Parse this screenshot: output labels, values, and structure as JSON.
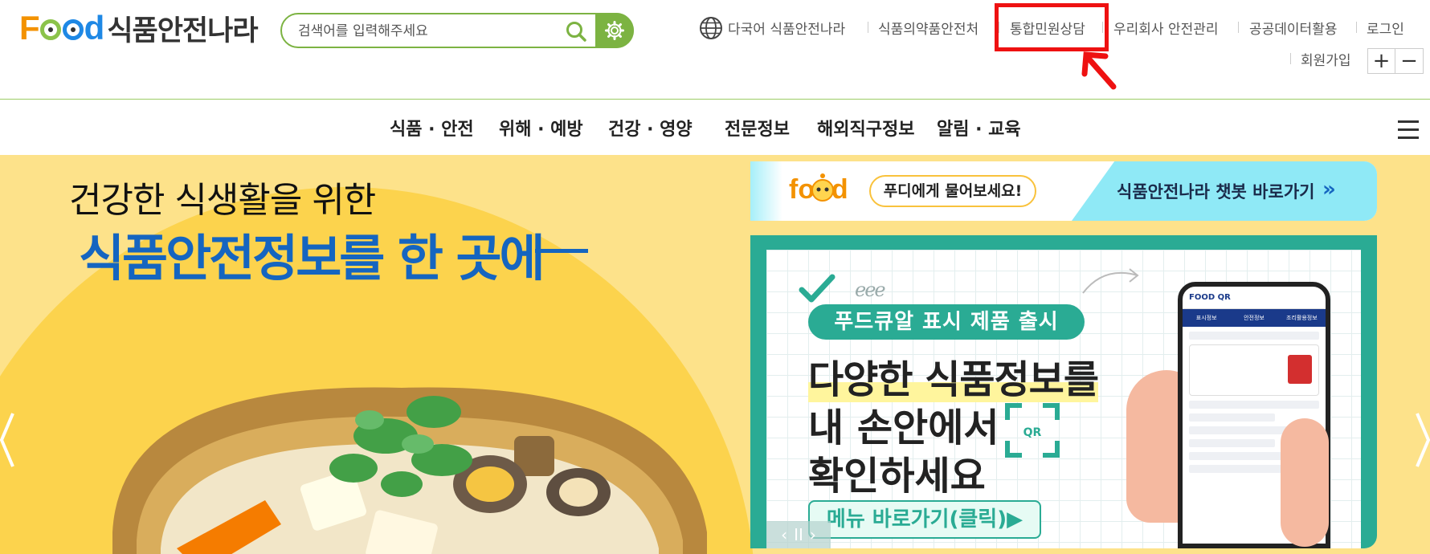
{
  "header": {
    "logo_food": "Food",
    "logo_kr": "식품안전나라",
    "search_placeholder": "검색어를 입력해주세요",
    "util_links": [
      {
        "label": "다국어 식품안전나라"
      },
      {
        "label": "식품의약품안전처"
      },
      {
        "label": "통합민원상담"
      },
      {
        "label": "우리회사 안전관리"
      },
      {
        "label": "공공데이터활용"
      },
      {
        "label": "로그인"
      },
      {
        "label": "회원가입"
      }
    ],
    "zoom_in": "+",
    "zoom_out": "−"
  },
  "gnb": {
    "items": [
      {
        "label": "식품 · 안전"
      },
      {
        "label": "위해 · 예방"
      },
      {
        "label": "건강 · 영양"
      },
      {
        "label": "전문정보"
      },
      {
        "label": "해외직구정보"
      },
      {
        "label": "알림 · 교육"
      }
    ]
  },
  "hero": {
    "subtitle": "건강한 식생활을 위한",
    "title": "식품안전정보를 한 곳에"
  },
  "chatbot": {
    "logo": "food",
    "bubble": "푸디에게 물어보세요!",
    "link": "식품안전나라 챗봇 바로가기",
    "arrow": "»"
  },
  "qr_banner": {
    "scribble": "eee",
    "pill": "푸드큐알 표시 제품 출시",
    "line1": "다양한 식품정보를",
    "line2": "내 손안에서",
    "line3": "확인하세요",
    "qr_label": "QR",
    "menu": "메뉴 바로가기(클릭)▶",
    "phone_title": "FOOD QR",
    "phone_tabs": [
      "표시정보",
      "안전정보",
      "조리활용정보"
    ],
    "ctrl_prev": "‹",
    "ctrl_pause": "II",
    "ctrl_next": "›"
  },
  "colors": {
    "brand_green": "#7cb342",
    "brand_blue": "#1565c0",
    "hero_bg": "#fde28a",
    "highlight_red": "#ee1111",
    "qr_teal": "#2aab94",
    "chatbot_cyan": "#8fe9f6"
  }
}
